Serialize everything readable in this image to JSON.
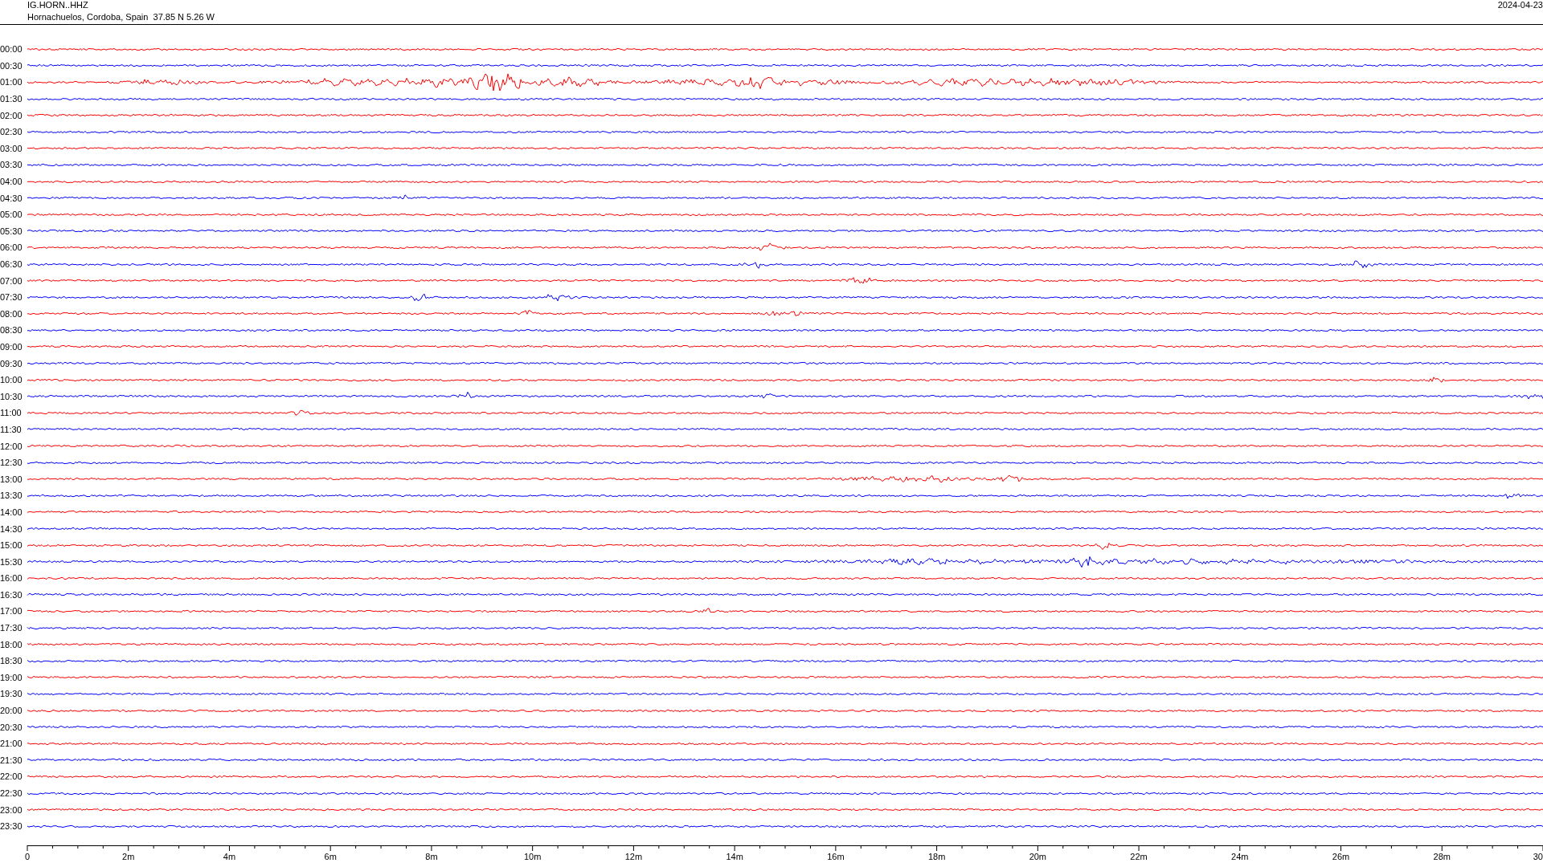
{
  "header": {
    "station": "IG.HORN..HHZ",
    "location": "Hornachuelos, Cordoba, Spain  37.85 N 5.26 W",
    "date": "2024-04-23"
  },
  "traces": [
    {
      "time": "00:00",
      "color": "#ff0000"
    },
    {
      "time": "00:30",
      "color": "#0000ff"
    },
    {
      "time": "01:00",
      "color": "#ff0000"
    },
    {
      "time": "01:30",
      "color": "#0000ff"
    },
    {
      "time": "02:00",
      "color": "#ff0000"
    },
    {
      "time": "02:30",
      "color": "#0000ff"
    },
    {
      "time": "03:00",
      "color": "#ff0000"
    },
    {
      "time": "03:30",
      "color": "#0000ff"
    },
    {
      "time": "04:00",
      "color": "#ff0000"
    },
    {
      "time": "04:30",
      "color": "#0000ff"
    },
    {
      "time": "05:00",
      "color": "#ff0000"
    },
    {
      "time": "05:30",
      "color": "#0000ff"
    },
    {
      "time": "06:00",
      "color": "#ff0000"
    },
    {
      "time": "06:30",
      "color": "#0000ff"
    },
    {
      "time": "07:00",
      "color": "#ff0000"
    },
    {
      "time": "07:30",
      "color": "#0000ff"
    },
    {
      "time": "08:00",
      "color": "#ff0000"
    },
    {
      "time": "08:30",
      "color": "#0000ff"
    },
    {
      "time": "09:00",
      "color": "#ff0000"
    },
    {
      "time": "09:30",
      "color": "#0000ff"
    },
    {
      "time": "10:00",
      "color": "#ff0000"
    },
    {
      "time": "10:30",
      "color": "#0000ff"
    },
    {
      "time": "11:00",
      "color": "#ff0000"
    },
    {
      "time": "11:30",
      "color": "#0000ff"
    },
    {
      "time": "12:00",
      "color": "#ff0000"
    },
    {
      "time": "12:30",
      "color": "#0000ff"
    },
    {
      "time": "13:00",
      "color": "#ff0000"
    },
    {
      "time": "13:30",
      "color": "#0000ff"
    },
    {
      "time": "14:00",
      "color": "#ff0000"
    },
    {
      "time": "14:30",
      "color": "#0000ff"
    },
    {
      "time": "15:00",
      "color": "#ff0000"
    },
    {
      "time": "15:30",
      "color": "#0000ff"
    },
    {
      "time": "16:00",
      "color": "#ff0000"
    },
    {
      "time": "16:30",
      "color": "#0000ff"
    },
    {
      "time": "17:00",
      "color": "#ff0000"
    },
    {
      "time": "17:30",
      "color": "#0000ff"
    },
    {
      "time": "18:00",
      "color": "#ff0000"
    },
    {
      "time": "18:30",
      "color": "#0000ff"
    },
    {
      "time": "19:00",
      "color": "#ff0000"
    },
    {
      "time": "19:30",
      "color": "#0000ff"
    },
    {
      "time": "20:00",
      "color": "#ff0000"
    },
    {
      "time": "20:30",
      "color": "#0000ff"
    },
    {
      "time": "21:00",
      "color": "#ff0000"
    },
    {
      "time": "21:30",
      "color": "#0000ff"
    },
    {
      "time": "22:00",
      "color": "#ff0000"
    },
    {
      "time": "22:30",
      "color": "#0000ff"
    },
    {
      "time": "23:00",
      "color": "#ff0000"
    },
    {
      "time": "23:30",
      "color": "#0000ff"
    }
  ],
  "x_axis": {
    "ticks": [
      "0",
      "2m",
      "4m",
      "6m",
      "8m",
      "10m",
      "12m",
      "14m",
      "16m",
      "18m",
      "20m",
      "22m",
      "24m",
      "26m",
      "28m",
      "30"
    ]
  }
}
